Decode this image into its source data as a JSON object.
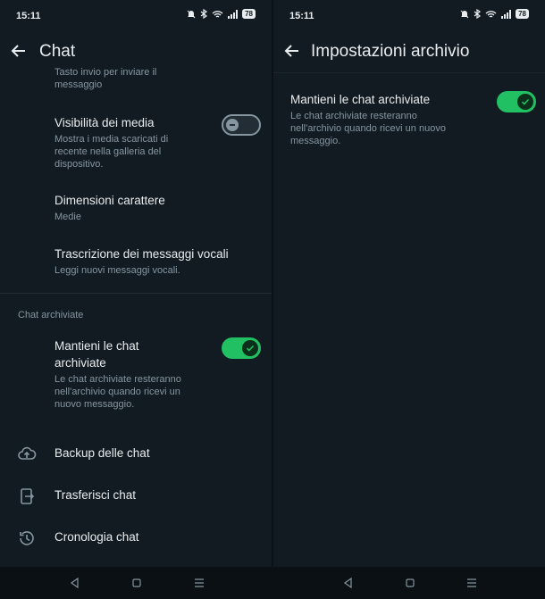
{
  "status": {
    "time": "15:11",
    "battery": "78"
  },
  "left": {
    "title": "Chat",
    "partial_item": {
      "line1": "Tasto invio per inviare il",
      "line2": "messaggio"
    },
    "media_visibility": {
      "title": "Visibilità dei media",
      "sub1": "Mostra i media scaricati di",
      "sub2": "recente nella galleria del",
      "sub3": "dispositivo.",
      "enabled": false
    },
    "font_size": {
      "title": "Dimensioni carattere",
      "sub": "Medie"
    },
    "voice_transcription": {
      "title": "Trascrizione dei messaggi vocali",
      "sub": "Leggi nuovi messaggi vocali."
    },
    "archived_section": "Chat archiviate",
    "keep_archived": {
      "title1": "Mantieni le chat",
      "title2": "archiviate",
      "sub1": "Le chat archiviate resteranno",
      "sub2": "nell'archivio quando ricevi un",
      "sub3": "nuovo messaggio.",
      "enabled": true
    },
    "backup": "Backup delle chat",
    "transfer": "Trasferisci chat",
    "history": "Cronologia chat"
  },
  "right": {
    "title": "Impostazioni archivio",
    "keep_archived": {
      "title": "Mantieni le chat archiviate",
      "sub1": "Le chat archiviate resteranno",
      "sub2": "nell'archivio quando ricevi un nuovo",
      "sub3": "messaggio.",
      "enabled": true
    }
  },
  "colors": {
    "accent": "#21c063",
    "background": "#121b22",
    "secondary_text": "#8696a0"
  }
}
